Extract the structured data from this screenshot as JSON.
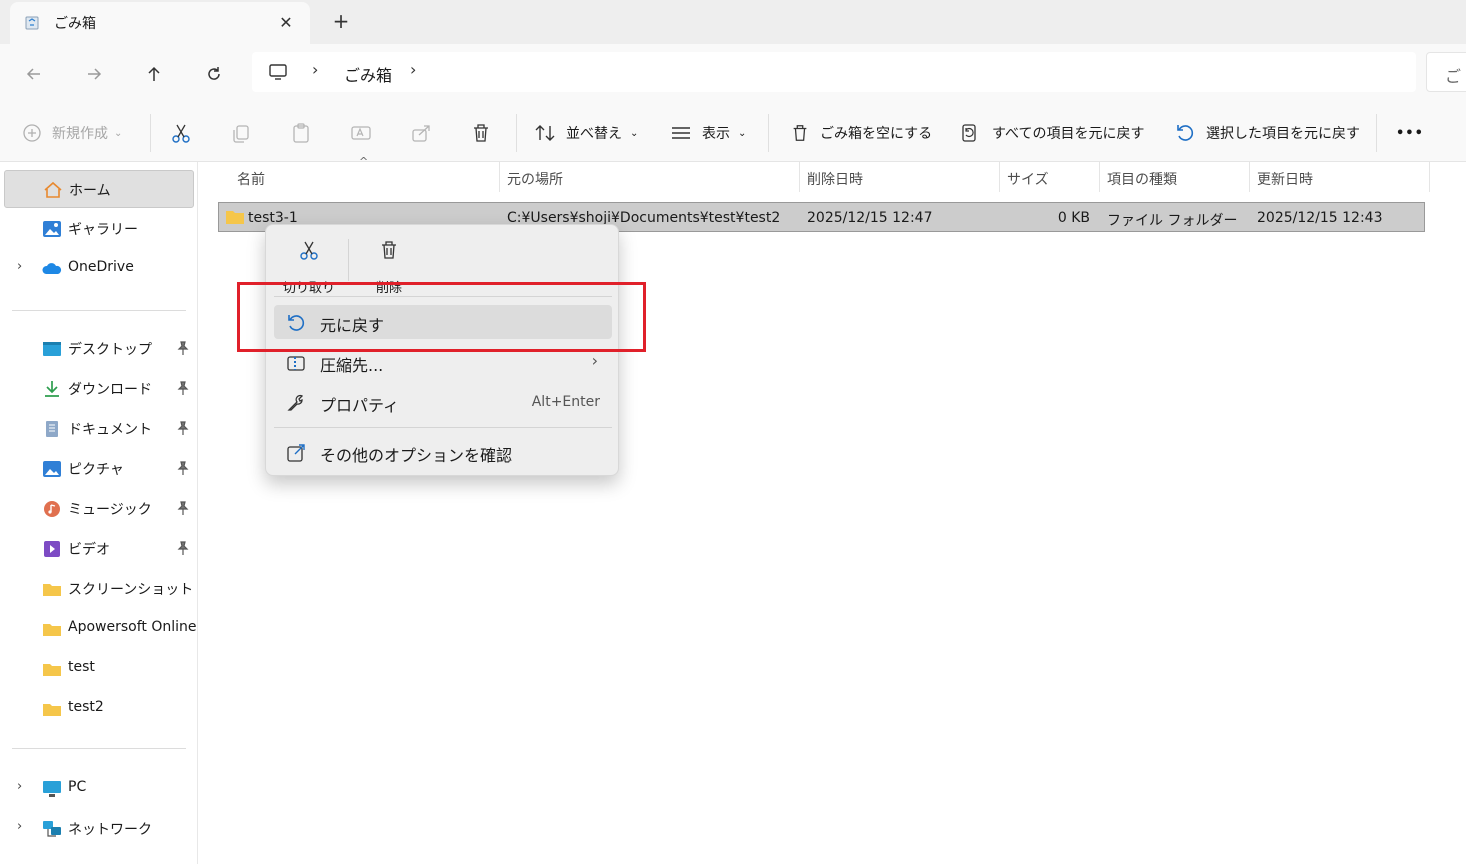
{
  "tab": {
    "title": "ごみ箱",
    "close": "✕",
    "new": "+"
  },
  "address": {
    "crumb": "ごみ箱",
    "sep": "›",
    "search_prefix": "ご"
  },
  "commands": {
    "new": "新規作成",
    "sort": "並べ替え",
    "view": "表示",
    "empty_bin": "ごみ箱を空にする",
    "restore_all": "すべての項目を元に戻す",
    "restore_selected": "選択した項目を元に戻す",
    "more": "•••"
  },
  "sidebar": {
    "home": "ホーム",
    "gallery": "ギャラリー",
    "onedrive": "OneDrive",
    "quick": [
      {
        "label": "デスクトップ"
      },
      {
        "label": "ダウンロード"
      },
      {
        "label": "ドキュメント"
      },
      {
        "label": "ピクチャ"
      },
      {
        "label": "ミュージック"
      },
      {
        "label": "ビデオ"
      },
      {
        "label": "スクリーンショット"
      },
      {
        "label": "Apowersoft Online"
      },
      {
        "label": "test"
      },
      {
        "label": "test2"
      }
    ],
    "pc": "PC",
    "network": "ネットワーク"
  },
  "columns": [
    "名前",
    "元の場所",
    "削除日時",
    "サイズ",
    "項目の種類",
    "更新日時"
  ],
  "rows": [
    {
      "name": "test3-1",
      "location": "C:¥Users¥shoji¥Documents¥test¥test2",
      "deleted": "2025/12/15 12:47",
      "size": "0 KB",
      "type": "ファイル フォルダー",
      "modified": "2025/12/15 12:43"
    }
  ],
  "context_menu": {
    "cut": "切り取り",
    "delete": "削除",
    "restore": "元に戻す",
    "compress": "圧縮先...",
    "properties": "プロパティ",
    "properties_shortcut": "Alt+Enter",
    "more_options": "その他のオプションを確認"
  },
  "colors": {
    "accent": "#0067c0",
    "highlight_box": "#e0202a",
    "folder": "#f5c64a"
  }
}
